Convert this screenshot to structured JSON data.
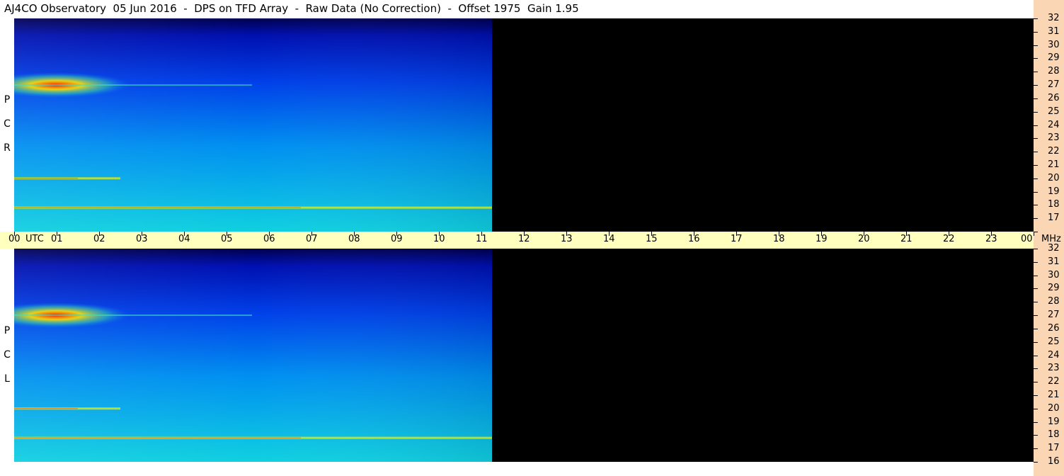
{
  "title": "AJ4CO Observatory  05 Jun 2016  -  DPS on TFD Array  -  Raw Data (No Correction)  -  Offset 1975  Gain 1.95",
  "utc_axis": {
    "labels": [
      "00",
      "01",
      "02",
      "03",
      "04",
      "05",
      "06",
      "07",
      "08",
      "09",
      "10",
      "11",
      "12",
      "13",
      "14",
      "15",
      "16",
      "17",
      "18",
      "19",
      "20",
      "21",
      "22",
      "23",
      "00"
    ],
    "utc_text": "UTC",
    "mhz_text": "MHz"
  },
  "panels": [
    {
      "name": "rcp",
      "letters": [
        "R",
        "C",
        "P"
      ]
    },
    {
      "name": "lcp",
      "letters": [
        "L",
        "C",
        "P"
      ]
    }
  ],
  "chart_data": {
    "type": "heatmap",
    "title": "AJ4CO Observatory  05 Jun 2016  -  DPS on TFD Array  -  Raw Data (No Correction)  -  Offset 1975  Gain 1.95",
    "x": {
      "label": "UTC",
      "range": [
        0,
        24
      ],
      "ticks": [
        "00",
        "01",
        "02",
        "03",
        "04",
        "05",
        "06",
        "07",
        "08",
        "09",
        "10",
        "11",
        "12",
        "13",
        "14",
        "15",
        "16",
        "17",
        "18",
        "19",
        "20",
        "21",
        "22",
        "23",
        "00"
      ]
    },
    "y": {
      "label": "MHz",
      "range": [
        16,
        32
      ],
      "ticks": [
        16,
        17,
        18,
        19,
        20,
        21,
        22,
        23,
        24,
        25,
        26,
        27,
        28,
        29,
        30,
        31,
        32
      ]
    },
    "data_end_utc": 11.25,
    "panels": [
      "RCP",
      "LCP"
    ],
    "colormap": [
      "#00008b",
      "#0000ff",
      "#0080ff",
      "#00c0e0",
      "#40e0a0",
      "#ffff00",
      "#ff0000"
    ],
    "features": [
      {
        "panel": "RCP",
        "utc_range": [
          0,
          3.5
        ],
        "mhz": 27,
        "intensity": "high"
      },
      {
        "panel": "RCP",
        "utc_range": [
          0,
          11.25
        ],
        "mhz": 17.8,
        "intensity": "medium"
      },
      {
        "panel": "RCP",
        "utc_range": [
          0,
          2.5
        ],
        "mhz": 20,
        "intensity": "medium"
      },
      {
        "panel": "LCP",
        "utc_range": [
          0,
          3.5
        ],
        "mhz": 27,
        "intensity": "high"
      },
      {
        "panel": "LCP",
        "utc_range": [
          0,
          11.25
        ],
        "mhz": 17.8,
        "intensity": "medium"
      },
      {
        "panel": "LCP",
        "utc_range": [
          0,
          2.5
        ],
        "mhz": 20,
        "intensity": "medium"
      }
    ]
  }
}
